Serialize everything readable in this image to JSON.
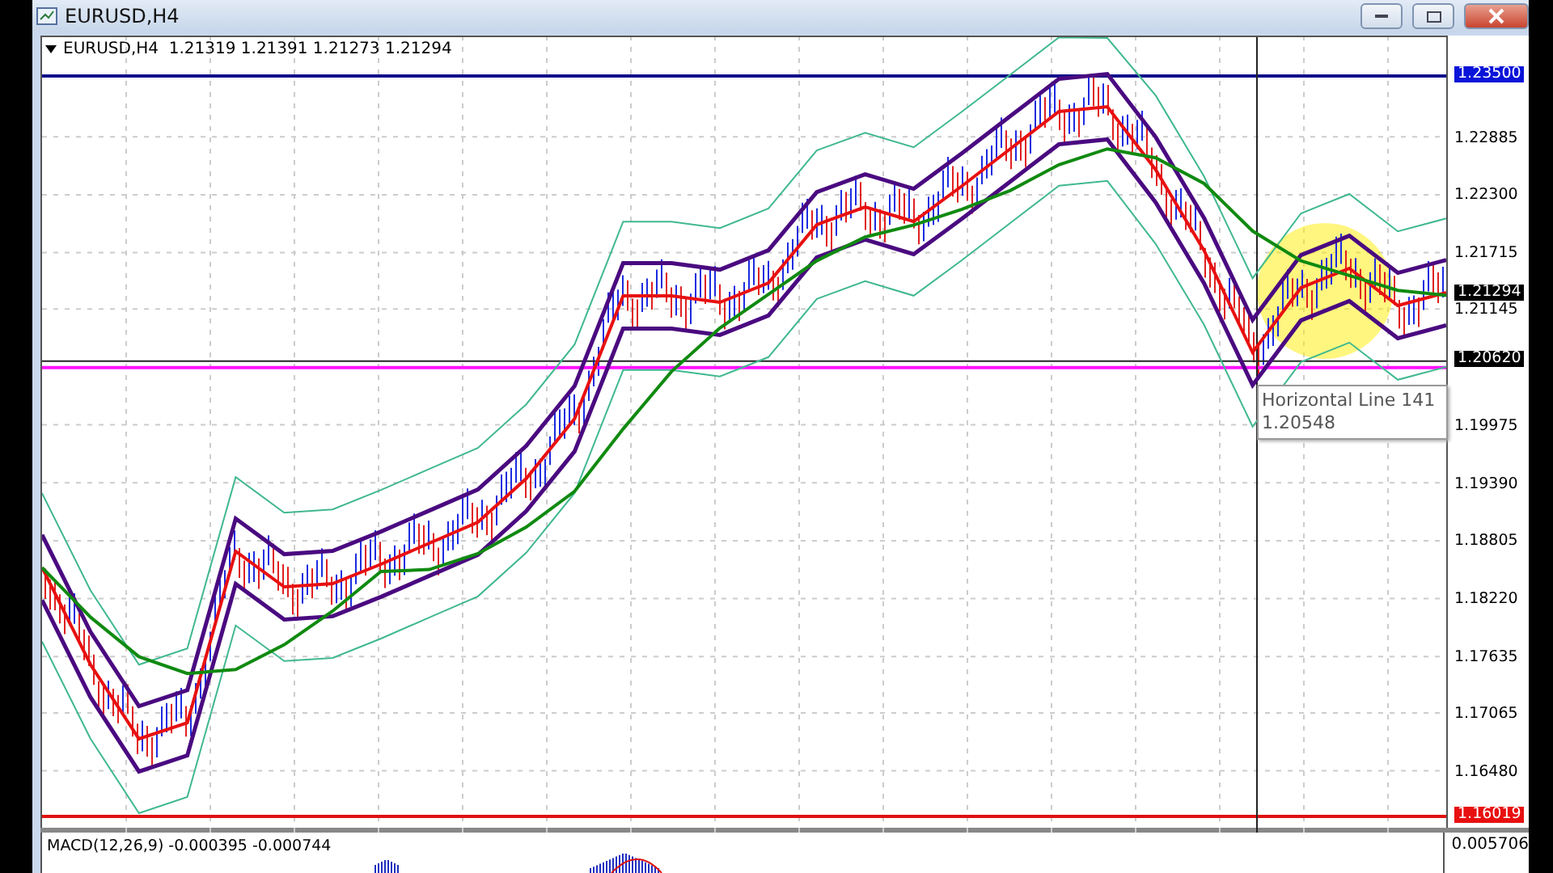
{
  "window": {
    "title": "EURUSD,H4"
  },
  "chart": {
    "header": "EURUSD,H4  1.21319 1.21391 1.21273 1.21294",
    "chart_data": {
      "type": "line",
      "grid": true,
      "ylim": [
        1.15856,
        1.23908
      ],
      "yticks": [
        {
          "value": 1.22885,
          "label": "1.22885"
        },
        {
          "value": 1.223,
          "label": "1.22300"
        },
        {
          "value": 1.21715,
          "label": "1.21715"
        },
        {
          "value": 1.21145,
          "label": "1.21145"
        },
        {
          "value": 1.19975,
          "label": "1.19975"
        },
        {
          "value": 1.1939,
          "label": "1.19390"
        },
        {
          "value": 1.18805,
          "label": "1.18805"
        },
        {
          "value": 1.1822,
          "label": "1.18220"
        },
        {
          "value": 1.17635,
          "label": "1.17635"
        },
        {
          "value": 1.17065,
          "label": "1.17065"
        },
        {
          "value": 1.1648,
          "label": "1.16480"
        }
      ],
      "series": [
        {
          "color": "#40b890",
          "values": [
            1.19301,
            1.18321,
            1.17569,
            1.17732,
            1.19464,
            1.19105,
            1.19137,
            1.19333,
            1.19546,
            1.19758,
            1.20199,
            1.20803,
            1.22045,
            1.22045,
            1.21979,
            1.22176,
            1.22764,
            1.22943,
            1.22796,
            1.23156,
            1.23531,
            1.23907,
            1.239,
            1.23319,
            1.22502,
            1.21473,
            1.22127,
            1.22323,
            1.21947,
            1.22077
          ]
        },
        {
          "color": "#40b890",
          "values": [
            1.17801,
            1.16821,
            1.16069,
            1.16232,
            1.17964,
            1.17605,
            1.17637,
            1.17833,
            1.18046,
            1.18258,
            1.18699,
            1.19303,
            1.20545,
            1.20545,
            1.20479,
            1.20676,
            1.21264,
            1.21443,
            1.21296,
            1.21656,
            1.22031,
            1.22407,
            1.22456,
            1.21819,
            1.21002,
            1.19973,
            1.20627,
            1.20823,
            1.20447,
            1.20577
          ]
        },
        {
          "color": "#4a0a80",
          "values": [
            1.18881,
            1.17901,
            1.17149,
            1.17312,
            1.19044,
            1.18685,
            1.18717,
            1.18913,
            1.19126,
            1.19338,
            1.19779,
            1.20383,
            1.21625,
            1.21625,
            1.21559,
            1.21756,
            1.22344,
            1.22523,
            1.22376,
            1.22736,
            1.23111,
            1.23487,
            1.23536,
            1.22899,
            1.22082,
            1.21053,
            1.21707,
            1.21903,
            1.21527,
            1.21657
          ]
        },
        {
          "color": "#4a0a80",
          "values": [
            1.18221,
            1.17241,
            1.16489,
            1.16652,
            1.18384,
            1.18025,
            1.18057,
            1.18253,
            1.18466,
            1.18678,
            1.19119,
            1.19723,
            1.20965,
            1.20965,
            1.20899,
            1.21096,
            1.21684,
            1.21863,
            1.21716,
            1.22076,
            1.22451,
            1.22827,
            1.22876,
            1.22239,
            1.21422,
            1.20393,
            1.21047,
            1.21243,
            1.20867,
            1.20997
          ]
        },
        {
          "color": "#e81010",
          "values": [
            1.18551,
            1.17571,
            1.16819,
            1.16982,
            1.18714,
            1.18355,
            1.18387,
            1.18583,
            1.18796,
            1.19008,
            1.19449,
            1.20053,
            1.21295,
            1.21295,
            1.21229,
            1.21426,
            1.22014,
            1.22193,
            1.22046,
            1.22406,
            1.22781,
            1.23157,
            1.23206,
            1.22569,
            1.21752,
            1.20723,
            1.21377,
            1.21573,
            1.21197,
            1.21327
          ]
        },
        {
          "color": "#108a10",
          "values": [
            1.1855,
            1.1805,
            1.1765,
            1.1748,
            1.1752,
            1.1777,
            1.1811,
            1.1851,
            1.1853,
            1.1869,
            1.1896,
            1.1932,
            1.1995,
            1.2053,
            1.2097,
            1.2131,
            1.2165,
            1.2189,
            1.2201,
            1.2217,
            1.2236,
            1.2262,
            1.2278,
            1.2269,
            1.2243,
            1.2195,
            1.2165,
            1.215,
            1.2135,
            1.213
          ]
        }
      ]
    },
    "price_labels": [
      {
        "text": "1.23500",
        "color": "#0a14d8"
      },
      {
        "text": "1.21294",
        "color": "#000000"
      },
      {
        "text": "1.20620",
        "color": "#000000"
      },
      {
        "text": "1.16019",
        "color": "#e81010"
      }
    ],
    "tooltip": {
      "title": "Horizontal Line 141",
      "value": "1.20548"
    }
  },
  "macd": {
    "label": "MACD(12,26,9) -0.000395 -0.000744",
    "axis_label": "0.005706"
  }
}
